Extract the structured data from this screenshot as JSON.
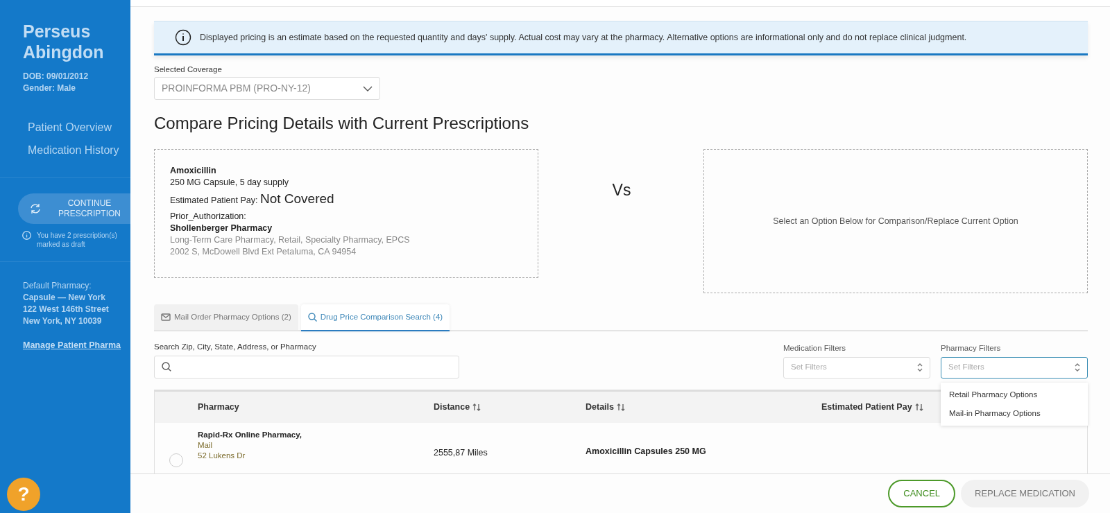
{
  "sidebar": {
    "patient_name": "Perseus Abingdon",
    "dob": "DOB: 09/01/2012",
    "gender": "Gender: Male",
    "nav": [
      {
        "label": "Patient Overview"
      },
      {
        "label": "Medication History"
      }
    ],
    "continue_button": "CONTINUE PRESCRIPTION",
    "draft_note": "You have 2 prescription(s) marked as draft",
    "default_pharmacy": {
      "label": "Default Pharmacy:",
      "lines": [
        "Capsule — New York",
        "122 West 146th Street",
        "New York, NY 10039"
      ]
    },
    "manage_link": "Manage Patient Pharma",
    "help_button": "?"
  },
  "modal": {
    "notice": "Displayed pricing is an estimate based on the requested quantity and days' supply. Actual cost may vary at the pharmacy. Alternative options are informational only and do not replace clinical judgment.",
    "coverage": {
      "label": "Selected Coverage",
      "value": "PROINFORMA PBM (PRO-NY-12)"
    },
    "heading": "Compare Pricing Details with Current Prescriptions",
    "current": {
      "drug": "Amoxicillin",
      "form": "250 MG Capsule, 5 day supply",
      "pay_label": "Estimated Patient Pay:",
      "pay_value": "Not Covered",
      "prior_auth": "Prior_Authorization:",
      "pharmacy": "Shollenberger Pharmacy",
      "types": "Long-Term Care Pharmacy, Retail, Specialty Pharmacy, EPCS",
      "address": "2002 S, McDowell Blvd Ext Petaluma, CA 94954"
    },
    "vs": "Vs",
    "compare_placeholder": "Select an Option Below for Comparison/Replace Current Option",
    "tabs": [
      {
        "label": "Mail Order Pharmacy Options (2)",
        "kind": "mail",
        "selected": false
      },
      {
        "label": "Drug Price Comparison Search (4)",
        "kind": "search",
        "selected": true
      }
    ],
    "search": {
      "label": "Search Zip, City, State, Address, or Pharmacy"
    },
    "filters": [
      {
        "label": "Medication Filters",
        "placeholder": "Set Filters",
        "focused": false
      },
      {
        "label": "Pharmacy Filters",
        "placeholder": "Set Filters",
        "focused": true
      }
    ],
    "dropdown": {
      "options": [
        "Retail Pharmacy Options",
        "Mail-in Pharmacy Options"
      ]
    },
    "table": {
      "columns": [
        {
          "label": "Pharmacy",
          "sortable": false
        },
        {
          "label": "Distance",
          "sortable": true
        },
        {
          "label": "Details",
          "sortable": true
        },
        {
          "label": "Estimated Patient Pay",
          "sortable": true
        }
      ],
      "rows": [
        {
          "selected": false,
          "pharmacy": "Rapid-Rx Online Pharmacy,",
          "type": "Mail",
          "address": "52 Lukens Dr",
          "distance": "2555,87 Miles",
          "details_title": "Amoxicillin Capsules 250 MG"
        }
      ]
    },
    "buttons": [
      {
        "label": "CANCEL",
        "kind": "outline"
      },
      {
        "label": "REPLACE MEDICATION",
        "kind": "disabled"
      }
    ]
  }
}
